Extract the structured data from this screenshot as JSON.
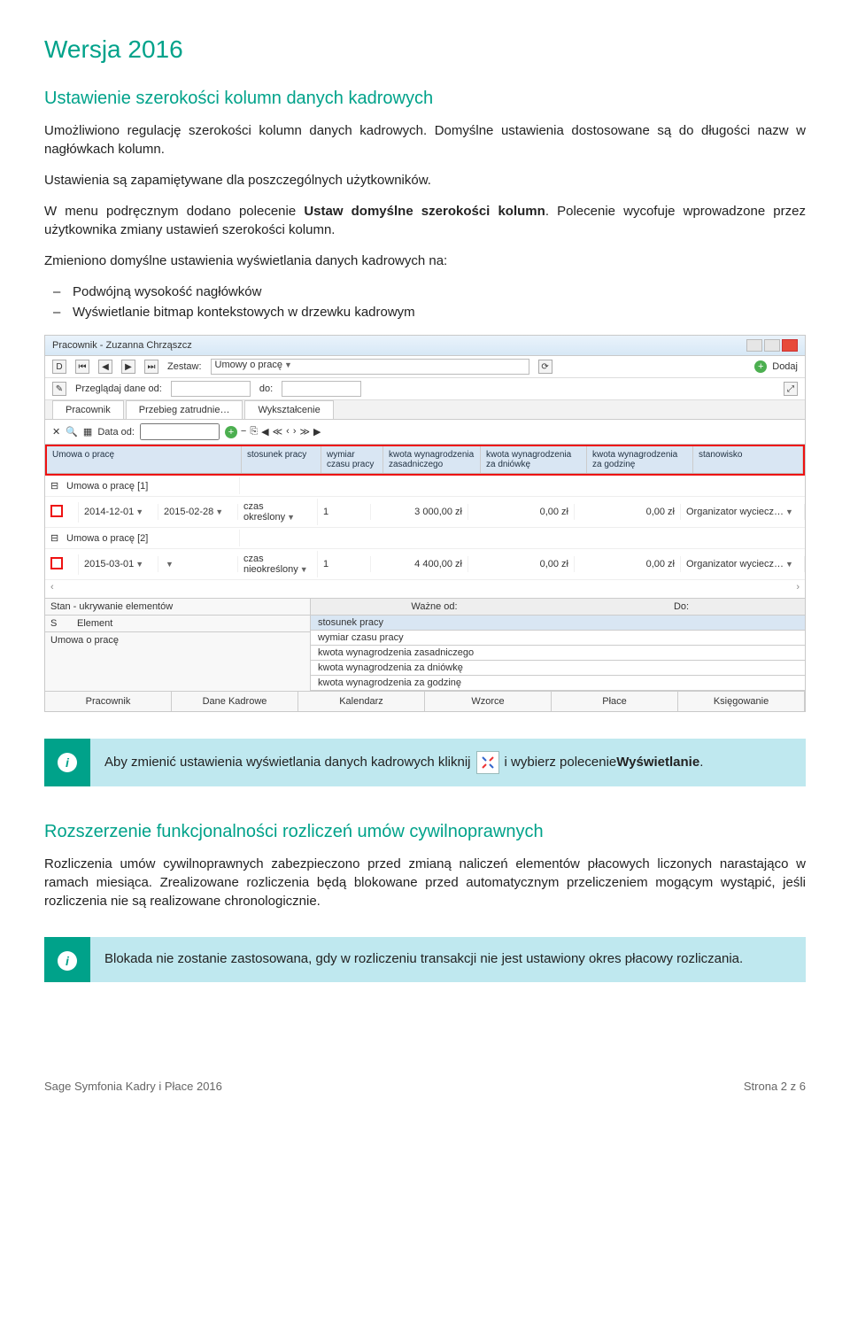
{
  "title": "Wersja 2016",
  "section1": {
    "heading": "Ustawienie szerokości kolumn danych kadrowych",
    "p1": "Umożliwiono regulację szerokości kolumn danych kadrowych. Domyślne ustawienia dostosowane są do długości nazw w nagłówkach kolumn.",
    "p2": "Ustawienia są zapamiętywane dla poszczególnych użytkowników.",
    "p3a": "W menu podręcznym dodano polecenie ",
    "p3b": "Ustaw domyślne szerokości kolumn",
    "p3c": ". Polecenie wycofuje wprowadzone przez użytkownika zmiany ustawień szerokości kolumn.",
    "p4": "Zmieniono domyślne ustawienia wyświetlania danych kadrowych na:",
    "bullets": [
      "Podwójną wysokość nagłówków",
      "Wyświetlanie bitmap kontekstowych w drzewku kadrowym"
    ]
  },
  "screenshot": {
    "window_title": "Pracownik - Zuzanna Chrząszcz",
    "row1": {
      "d": "D",
      "zestaw_label": "Zestaw:",
      "zestaw_value": "Umowy o pracę",
      "dodaj": "Dodaj"
    },
    "row2": {
      "label": "Przeglądaj dane od:",
      "do": "do:"
    },
    "tabs": [
      "Pracownik",
      "Przebieg zatrudnie…",
      "Wykształcenie"
    ],
    "toolbar2": {
      "data_od": "Data od:"
    },
    "columns": [
      "Umowa o pracę",
      "stosunek pracy",
      "wymiar czasu pracy",
      "kwota wynagrodzenia zasadniczego",
      "kwota wynagrodzenia za dniówkę",
      "kwota wynagrodzenia za godzinę",
      "stanowisko"
    ],
    "group1_label": "Umowa o pracę [1]",
    "group2_label": "Umowa o pracę [2]",
    "rows": [
      {
        "d1": "2014-12-01",
        "d2": "2015-02-28",
        "typ": "czas określony",
        "wym": "1",
        "k1": "3 000,00 zł",
        "k2": "0,00 zł",
        "k3": "0,00 zł",
        "stan": "Organizator wyciecz…"
      },
      {
        "d1": "2015-03-01",
        "d2": "",
        "typ": "czas nieokreślony",
        "wym": "1",
        "k1": "4 400,00 zł",
        "k2": "0,00 zł",
        "k3": "0,00 zł",
        "stan": "Organizator wyciecz…"
      }
    ],
    "bottom_left": {
      "title": "Stan - ukrywanie elementów",
      "s": "S",
      "element": "Element",
      "row": "Umowa o pracę"
    },
    "bottom_right": {
      "wazne": "Ważne od:",
      "do": "Do:",
      "rows": [
        "stosunek pracy",
        "wymiar czasu pracy",
        "kwota wynagrodzenia zasadniczego",
        "kwota wynagrodzenia za dniówkę",
        "kwota wynagrodzenia za godzinę"
      ]
    },
    "bottom_tabs": [
      "Pracownik",
      "Dane Kadrowe",
      "Kalendarz",
      "Wzorce",
      "Płace",
      "Księgowanie"
    ]
  },
  "info1": {
    "t1": "Aby zmienić ustawienia wyświetlania danych kadrowych kliknij",
    "t2": "i wybierz polecenie ",
    "t3": "Wyświetlanie",
    "t4": "."
  },
  "section2": {
    "heading": "Rozszerzenie funkcjonalności rozliczeń umów cywilnoprawnych",
    "p1": "Rozliczenia umów cywilnoprawnych zabezpieczono przed zmianą naliczeń elementów płacowych liczonych narastająco w ramach miesiąca. Zrealizowane rozliczenia będą blokowane przed automatycznym przeliczeniem mogącym wystąpić, jeśli rozliczenia nie są realizowane chronologicznie."
  },
  "info2": {
    "text": "Blokada nie zostanie zastosowana, gdy w rozliczeniu transakcji nie jest ustawiony okres płacowy rozliczania."
  },
  "footer": {
    "left": "Sage Symfonia Kadry i Płace 2016",
    "right": "Strona 2 z 6"
  }
}
